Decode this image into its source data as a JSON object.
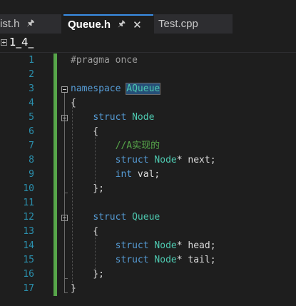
{
  "tabs": [
    {
      "label": "ist.h",
      "pin_icon": "pin-icon",
      "active": false
    },
    {
      "label": "Queue.h",
      "pin_icon": "pin-icon",
      "close_icon": "close-icon",
      "active": true
    },
    {
      "label": "Test.cpp",
      "active": false
    }
  ],
  "navbar": {
    "scope": "1_4_"
  },
  "editor": {
    "line_numbers": [
      "1",
      "2",
      "3",
      "4",
      "5",
      "6",
      "7",
      "8",
      "9",
      "10",
      "11",
      "12",
      "13",
      "14",
      "15",
      "16",
      "17"
    ],
    "lines": [
      {
        "parts": [
          {
            "t": "#pragma once",
            "c": "pp"
          }
        ]
      },
      {
        "parts": []
      },
      {
        "parts": [
          {
            "t": "namespace",
            "c": "kw"
          },
          {
            "t": " ",
            "c": "id"
          },
          {
            "t": "AQueue",
            "c": "type hl"
          }
        ]
      },
      {
        "parts": [
          {
            "t": "{",
            "c": "id"
          }
        ]
      },
      {
        "parts": [
          {
            "t": "    ",
            "c": "id"
          },
          {
            "t": "struct",
            "c": "kw"
          },
          {
            "t": " ",
            "c": "id"
          },
          {
            "t": "Node",
            "c": "type"
          }
        ]
      },
      {
        "parts": [
          {
            "t": "    {",
            "c": "id"
          }
        ]
      },
      {
        "parts": [
          {
            "t": "        ",
            "c": "id"
          },
          {
            "t": "//A实现的",
            "c": "cm"
          }
        ]
      },
      {
        "parts": [
          {
            "t": "        ",
            "c": "id"
          },
          {
            "t": "struct",
            "c": "kw"
          },
          {
            "t": " ",
            "c": "id"
          },
          {
            "t": "Node",
            "c": "type"
          },
          {
            "t": "* next;",
            "c": "id"
          }
        ]
      },
      {
        "parts": [
          {
            "t": "        ",
            "c": "id"
          },
          {
            "t": "int",
            "c": "kw"
          },
          {
            "t": " val;",
            "c": "id"
          }
        ]
      },
      {
        "parts": [
          {
            "t": "    };",
            "c": "id"
          }
        ]
      },
      {
        "parts": []
      },
      {
        "parts": [
          {
            "t": "    ",
            "c": "id"
          },
          {
            "t": "struct",
            "c": "kw"
          },
          {
            "t": " ",
            "c": "id"
          },
          {
            "t": "Queue",
            "c": "type"
          }
        ]
      },
      {
        "parts": [
          {
            "t": "    {",
            "c": "id"
          }
        ]
      },
      {
        "parts": [
          {
            "t": "        ",
            "c": "id"
          },
          {
            "t": "struct",
            "c": "kw"
          },
          {
            "t": " ",
            "c": "id"
          },
          {
            "t": "Node",
            "c": "type"
          },
          {
            "t": "* head;",
            "c": "id"
          }
        ]
      },
      {
        "parts": [
          {
            "t": "        ",
            "c": "id"
          },
          {
            "t": "struct",
            "c": "kw"
          },
          {
            "t": " ",
            "c": "id"
          },
          {
            "t": "Node",
            "c": "type"
          },
          {
            "t": "* tail;",
            "c": "id"
          }
        ]
      },
      {
        "parts": [
          {
            "t": "    };",
            "c": "id"
          }
        ]
      },
      {
        "parts": [
          {
            "t": "}",
            "c": "id"
          }
        ]
      }
    ]
  },
  "colors": {
    "background": "#1e1e1e",
    "keyword": "#569cd6",
    "type": "#4ec9b0",
    "comment": "#57a64a",
    "line_number": "#2b91af",
    "change_bar": "#57a64a",
    "active_tab_accent": "#3a8ee6"
  }
}
